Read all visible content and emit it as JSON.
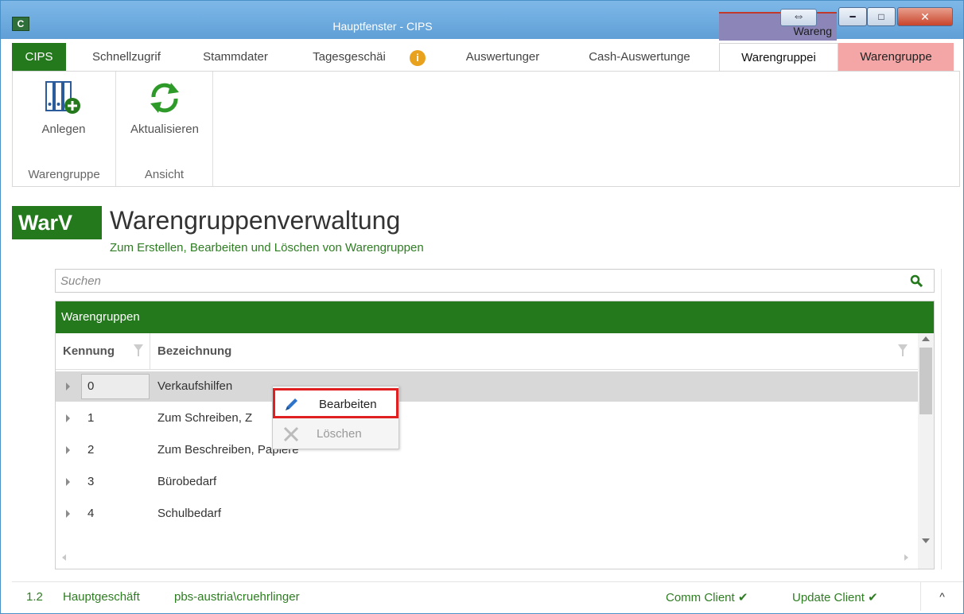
{
  "window": {
    "title": "Hauptfenster - CIPS",
    "app_icon_glyph": "C",
    "title_tab_label": "Wareng",
    "title_tab_color": "#8c86b8"
  },
  "tabs": [
    {
      "label": "CIPS"
    },
    {
      "label": "Schnellzugrif"
    },
    {
      "label": "Stammdater"
    },
    {
      "label": "Tagesgeschäi"
    },
    {
      "label": "Auswertunger"
    },
    {
      "label": "Cash-Auswertunge"
    },
    {
      "label": "Warengruppei"
    },
    {
      "label": "Warengruppe"
    }
  ],
  "ribbon": {
    "groups": [
      {
        "label": "Warengruppe",
        "buttons": [
          {
            "label": "Anlegen",
            "icon": "binders-add-icon"
          }
        ]
      },
      {
        "label": "Ansicht",
        "buttons": [
          {
            "label": "Aktualisieren",
            "icon": "refresh-icon"
          }
        ]
      }
    ]
  },
  "header": {
    "logo": "WarV",
    "title": "Warengruppenverwaltung",
    "subtitle": "Zum Erstellen, Bearbeiten und Löschen von Warengruppen"
  },
  "search": {
    "placeholder": "Suchen",
    "value": ""
  },
  "grid": {
    "group_header": "Warengruppen",
    "columns": [
      "Kennung",
      "Bezeichnung"
    ],
    "rows": [
      {
        "id": "0",
        "name": "Verkaufshilfen",
        "selected": true
      },
      {
        "id": "1",
        "name": "Zum Schreiben, Z"
      },
      {
        "id": "2",
        "name": "Zum Beschreiben, Papiere"
      },
      {
        "id": "3",
        "name": "Bürobedarf"
      },
      {
        "id": "4",
        "name": "Schulbedarf"
      }
    ]
  },
  "context_menu": {
    "items": [
      {
        "label": "Bearbeiten",
        "icon": "pencil-icon",
        "enabled": true
      },
      {
        "label": "Löschen",
        "icon": "x-icon",
        "enabled": false
      }
    ]
  },
  "statusbar": {
    "version": "1.2",
    "store": "Hauptgeschäft",
    "user": "pbs-austria\\cruehrlinger",
    "comm_client": "Comm Client",
    "update_client": "Update Client",
    "expand": "^"
  },
  "colors": {
    "brand_green": "#23791b",
    "highlight_red": "#e02020",
    "tab_pink": "#f4a6a6"
  }
}
